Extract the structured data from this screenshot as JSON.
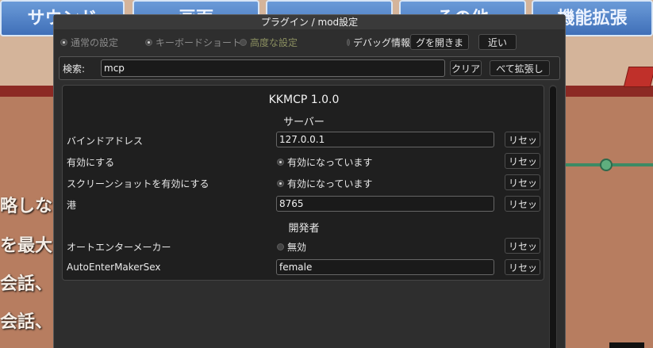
{
  "background": {
    "tabs": [
      "サウンド",
      "画面",
      "",
      "その他",
      "機能拡張"
    ],
    "left_text": [
      "略しなし",
      "を最大",
      "会話、",
      "会話、"
    ]
  },
  "window": {
    "title": "プラグイン / mod設定",
    "tabs": [
      {
        "label": "通常の設定",
        "selected": false
      },
      {
        "label": "キーボードショート",
        "selected": false
      },
      {
        "label": "高度な設定",
        "selected": false
      }
    ],
    "debug_label": "デバッグ情報",
    "open_button": "グを開きま",
    "close_button": "近い",
    "search": {
      "label": "検索:",
      "value": "mcp",
      "clear_button": "クリア",
      "expand_button": "べて拡張し"
    }
  },
  "plugin": {
    "name": "KKMCP 1.0.0",
    "sections": [
      {
        "category": "サーバー",
        "settings": [
          {
            "label": "バインドアドレス",
            "type": "text",
            "value": "127.0.0.1"
          },
          {
            "label": "有効にする",
            "type": "toggle",
            "checked": true,
            "value": "有効になっています"
          },
          {
            "label": "スクリーンショットを有効にする",
            "type": "toggle",
            "checked": true,
            "value": "有効になっています"
          },
          {
            "label": "港",
            "type": "text",
            "value": "8765"
          }
        ]
      },
      {
        "category": "開発者",
        "settings": [
          {
            "label": "オートエンターメーカー",
            "type": "toggle",
            "checked": false,
            "value": "無効"
          },
          {
            "label": "AutoEnterMakerSex",
            "type": "text",
            "value": "female"
          }
        ]
      }
    ],
    "reset_label": "リセット"
  }
}
